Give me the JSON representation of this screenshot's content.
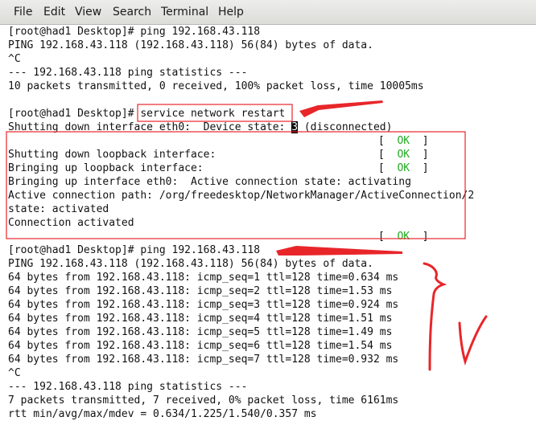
{
  "menu": {
    "file": "File",
    "edit": "Edit",
    "view": "View",
    "search": "Search",
    "terminal": "Terminal",
    "help": "Help"
  },
  "terminal": {
    "lines": [
      {
        "text": "[root@had1 Desktop]# ping 192.168.43.118"
      },
      {
        "text": "PING 192.168.43.118 (192.168.43.118) 56(84) bytes of data."
      },
      {
        "text": "^C"
      },
      {
        "text": "--- 192.168.43.118 ping statistics ---"
      },
      {
        "text": "10 packets transmitted, 0 received, 100% packet loss, time 10005ms"
      },
      {
        "text": ""
      },
      {
        "text": "[root@had1 Desktop]# service network restart"
      },
      {
        "pre": "Shutting down interface eth0:  Device state: ",
        "cursor": "3",
        "post": " (disconnected)"
      },
      {
        "pre": "",
        "ok_label": "OK"
      },
      {
        "text": "Shutting down loopback interface:",
        "ok_label": "OK"
      },
      {
        "text": "Bringing up loopback interface:",
        "ok_label": "OK"
      },
      {
        "text": "Bringing up interface eth0:  Active connection state: activating"
      },
      {
        "text": "Active connection path: /org/freedesktop/NetworkManager/ActiveConnection/2"
      },
      {
        "text": "state: activated"
      },
      {
        "text": "Connection activated"
      },
      {
        "pre": "",
        "ok_label": "OK"
      },
      {
        "text": "[root@had1 Desktop]# ping 192.168.43.118"
      },
      {
        "text": "PING 192.168.43.118 (192.168.43.118) 56(84) bytes of data."
      },
      {
        "text": "64 bytes from 192.168.43.118: icmp_seq=1 ttl=128 time=0.634 ms"
      },
      {
        "text": "64 bytes from 192.168.43.118: icmp_seq=2 ttl=128 time=1.53 ms"
      },
      {
        "text": "64 bytes from 192.168.43.118: icmp_seq=3 ttl=128 time=0.924 ms"
      },
      {
        "text": "64 bytes from 192.168.43.118: icmp_seq=4 ttl=128 time=1.51 ms"
      },
      {
        "text": "64 bytes from 192.168.43.118: icmp_seq=5 ttl=128 time=1.49 ms"
      },
      {
        "text": "64 bytes from 192.168.43.118: icmp_seq=6 ttl=128 time=1.54 ms"
      },
      {
        "text": "64 bytes from 192.168.43.118: icmp_seq=7 ttl=128 time=0.932 ms"
      },
      {
        "text": "^C"
      },
      {
        "text": "--- 192.168.43.118 ping statistics ---"
      },
      {
        "text": "7 packets transmitted, 7 received, 0% packet loss, time 6161ms"
      },
      {
        "text": "rtt min/avg/max/mdev = 0.634/1.225/1.540/0.357 ms"
      }
    ]
  },
  "colors": {
    "annotation": "#e8262a",
    "ok": "#22aa22"
  }
}
